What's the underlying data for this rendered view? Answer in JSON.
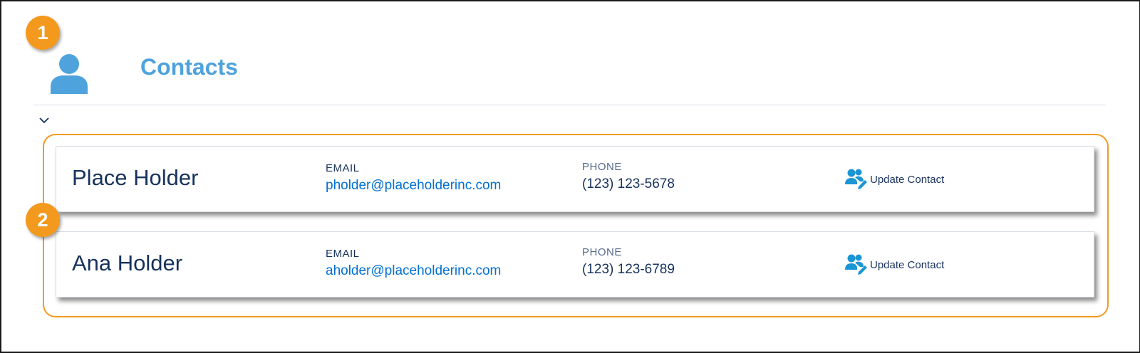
{
  "header": {
    "title": "Contacts",
    "icon": "contact-icon"
  },
  "colors": {
    "accent": "#4fa3dc",
    "callout": "#f39a1e",
    "link": "#0070d2",
    "text": "#16325c"
  },
  "callouts": [
    "1",
    "2"
  ],
  "contacts": [
    {
      "name": "Place Holder",
      "email_label": "EMAIL",
      "email": "pholder@placeholderinc.com",
      "phone_label": "PHONE",
      "phone": "(123) 123-5678",
      "action_label": "Update Contact",
      "action_icon": "update-contact-icon"
    },
    {
      "name": "Ana Holder",
      "email_label": "EMAIL",
      "email": "aholder@placeholderinc.com",
      "phone_label": "PHONE",
      "phone": "(123) 123-6789",
      "action_label": "Update Contact",
      "action_icon": "update-contact-icon"
    }
  ]
}
